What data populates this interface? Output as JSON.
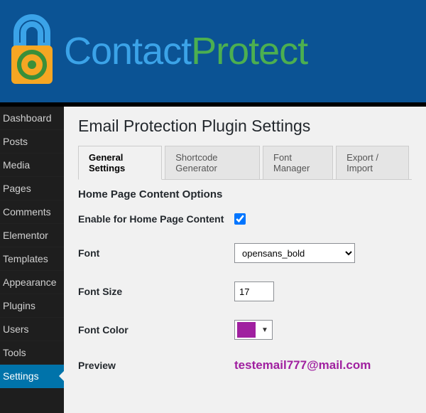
{
  "brand": {
    "part1": "Contact",
    "part2": "Protect"
  },
  "sidebar": {
    "items": [
      {
        "label": "Dashboard"
      },
      {
        "label": "Posts"
      },
      {
        "label": "Media"
      },
      {
        "label": "Pages"
      },
      {
        "label": "Comments"
      },
      {
        "label": "Elementor"
      },
      {
        "label": "Templates"
      },
      {
        "label": "Appearance"
      },
      {
        "label": "Plugins"
      },
      {
        "label": "Users"
      },
      {
        "label": "Tools"
      },
      {
        "label": "Settings"
      }
    ],
    "active_index": 11
  },
  "page": {
    "title": "Email Protection Plugin Settings"
  },
  "tabs": [
    {
      "label": "General Settings"
    },
    {
      "label": "Shortcode Generator"
    },
    {
      "label": "Font Manager"
    },
    {
      "label": "Export / Import"
    }
  ],
  "tabs_active_index": 0,
  "section": {
    "title": "Home Page Content Options"
  },
  "fields": {
    "enable_label": "Enable for Home Page Content",
    "enable_checked": true,
    "font_label": "Font",
    "font_value": "opensans_bold",
    "fontsize_label": "Font Size",
    "fontsize_value": "17",
    "fontcolor_label": "Font Color",
    "fontcolor_value": "#a020a0",
    "preview_label": "Preview",
    "preview_text": "testemail777@mail.com",
    "preview_color": "#a020a0"
  }
}
